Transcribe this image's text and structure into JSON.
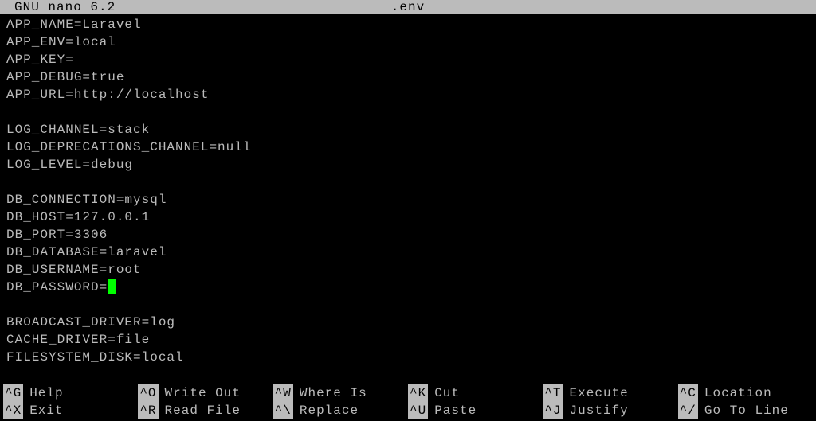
{
  "titlebar": {
    "app": "GNU nano 6.2",
    "filename": ".env"
  },
  "lines": [
    "APP_NAME=Laravel",
    "APP_ENV=local",
    "APP_KEY=",
    "APP_DEBUG=true",
    "APP_URL=http://localhost",
    "",
    "LOG_CHANNEL=stack",
    "LOG_DEPRECATIONS_CHANNEL=null",
    "LOG_LEVEL=debug",
    "",
    "DB_CONNECTION=mysql",
    "DB_HOST=127.0.0.1",
    "DB_PORT=3306",
    "DB_DATABASE=laravel",
    "DB_USERNAME=root",
    "DB_PASSWORD=",
    "",
    "BROADCAST_DRIVER=log",
    "CACHE_DRIVER=file",
    "FILESYSTEM_DISK=local"
  ],
  "cursor_line_index": 15,
  "shortcuts": [
    {
      "key": "^G",
      "label": "Help"
    },
    {
      "key": "^O",
      "label": "Write Out"
    },
    {
      "key": "^W",
      "label": "Where Is"
    },
    {
      "key": "^K",
      "label": "Cut"
    },
    {
      "key": "^T",
      "label": "Execute"
    },
    {
      "key": "^C",
      "label": "Location"
    },
    {
      "key": "^X",
      "label": "Exit"
    },
    {
      "key": "^R",
      "label": "Read File"
    },
    {
      "key": "^\\",
      "label": "Replace"
    },
    {
      "key": "^U",
      "label": "Paste"
    },
    {
      "key": "^J",
      "label": "Justify"
    },
    {
      "key": "^/",
      "label": "Go To Line"
    }
  ]
}
